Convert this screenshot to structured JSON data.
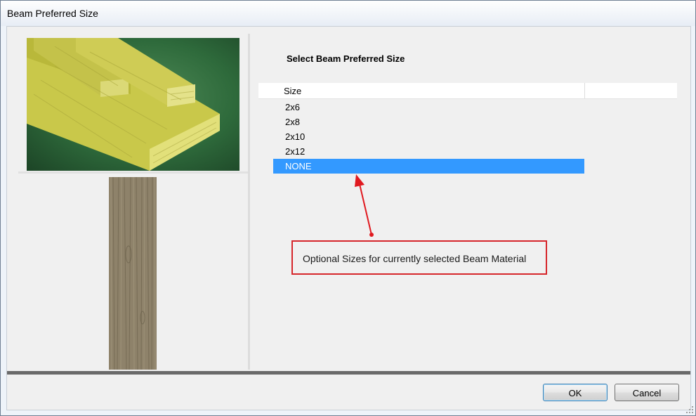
{
  "window": {
    "title": "Beam Preferred Size"
  },
  "main": {
    "heading": "Select Beam Preferred Size",
    "grid": {
      "column_header": "Size",
      "rows": [
        "2x6",
        "2x8",
        "2x10",
        "2x12",
        "NONE"
      ],
      "selected": "NONE"
    }
  },
  "annotation": {
    "text": "Optional Sizes for currently selected Beam Material",
    "color": "#d6262b"
  },
  "buttons": {
    "ok_label": "OK",
    "cancel_label": "Cancel"
  },
  "colors": {
    "selection": "#3399ff",
    "photo_background": "#2e6a3b"
  }
}
